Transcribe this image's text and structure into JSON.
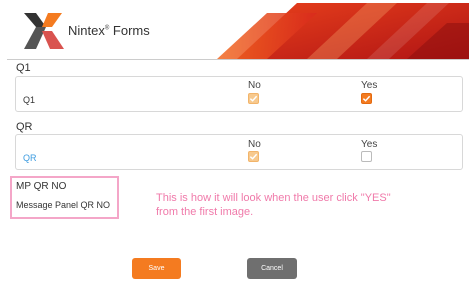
{
  "header": {
    "brand_name": "Nintex",
    "brand_reg": "®",
    "brand_product": "Forms"
  },
  "q1_section": {
    "title": "Q1",
    "col_no": "No",
    "col_yes": "Yes",
    "row_label": "Q1",
    "no_checked": true,
    "no_disabled": true,
    "yes_checked": true
  },
  "qr_section": {
    "title": "QR",
    "col_no": "No",
    "col_yes": "Yes",
    "row_label": "QR",
    "no_checked": true,
    "no_disabled": true,
    "yes_checked": false
  },
  "mp_panel": {
    "label": "MP QR NO",
    "message": "Message Panel QR NO"
  },
  "annotation": {
    "text": "This is how it will look when the user click \"YES\" from the first image."
  },
  "buttons": {
    "save": "Save",
    "cancel": "Cancel"
  },
  "colors": {
    "accent": "#f47b20",
    "checkbox_disabled": "#f7c98e",
    "cancel_button": "#6f6f6f",
    "highlight": "#f4a6c8",
    "annotation_text": "#f07aaa",
    "link": "#3b9be0"
  },
  "icons": {
    "logo": "nintex-x-logo",
    "check": "checkmark-icon",
    "banner": "red-orange-banner-graphic"
  }
}
